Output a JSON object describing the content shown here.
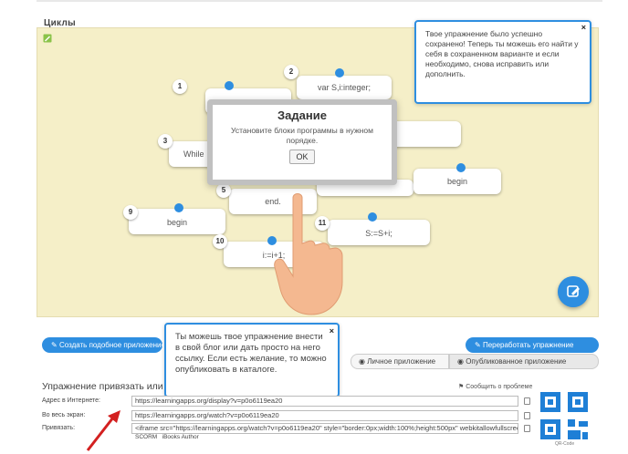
{
  "app": {
    "title": "Циклы"
  },
  "blocks": [
    {
      "num": "1",
      "text": ""
    },
    {
      "num": "2",
      "text": "var S,i:integer;"
    },
    {
      "num": "3",
      "text": "While"
    },
    {
      "num": "5",
      "text": "end."
    },
    {
      "num": "",
      "text": "begin"
    },
    {
      "num": "9",
      "text": "begin"
    },
    {
      "num": "10",
      "text": "i:=i+1;"
    },
    {
      "num": "11",
      "text": "S:=S+i;"
    }
  ],
  "dialog": {
    "title": "Задание",
    "message": "Установите блоки программы в нужном порядке.",
    "ok": "OK"
  },
  "tip_top": {
    "text": "Твое упражнение было успешно сохранено! Теперь ты можешь его найти у себя в сохраненном варианте и если необходимо, снова исправить или дополнить.",
    "close": "×"
  },
  "tip_mid": {
    "text": "Ты можешь твое упражнение внести в свой блог или дать просто на него ссылку. Если есть желание, то можно опубликовать в каталоге.",
    "close": "×"
  },
  "buttons": {
    "create": "Создать подобное приложение",
    "rework": "Переработать упражнение",
    "private": "Личное приложение",
    "public": "Опубликованное приложение"
  },
  "share": {
    "title": "Упражнение привязать или",
    "report": "Сообщить о проблеме",
    "rows": [
      {
        "label": "Адрес в Интернете:",
        "value": "https://learningapps.org/display?v=p0o6119ea20"
      },
      {
        "label": "Во весь экран:",
        "value": "https://learningapps.org/watch?v=p0o6119ea20"
      },
      {
        "label": "Привязать:",
        "value": "<iframe src=\"https://learningapps.org/watch?v=p0o6119ea20\" style=\"border:0px;width:100%;height:500px\" webkitallowfullscreen=\"true\""
      }
    ],
    "scorm": "SCORM",
    "ibooks": "iBooks Author",
    "qr_caption": "QR-Code"
  },
  "colors": {
    "accent": "#2e8ee0",
    "board": "#f5efc8"
  }
}
